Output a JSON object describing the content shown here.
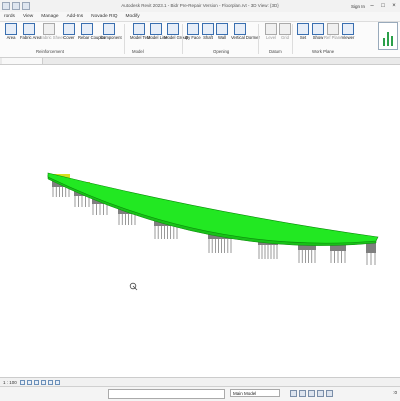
{
  "window": {
    "title": "Autodesk Revit 2023.1 - Bidr Pre-Repair Version - Floorplan.rvt - 3D View: {3D}",
    "signin_label": "Sign In",
    "minimize_glyph": "–",
    "maximize_glyph": "□",
    "close_glyph": "×"
  },
  "menubar": {
    "items": [
      "rords",
      "View",
      "Manage",
      "Add-Ins",
      "Novade RIQ",
      "Modify"
    ]
  },
  "ribbon": {
    "tools": [
      {
        "label": "Area",
        "style": "normal"
      },
      {
        "label": "Fabric Area",
        "style": "normal"
      },
      {
        "label": "Fabric Sheet",
        "style": "normal"
      },
      {
        "label": "Cover",
        "style": "normal"
      },
      {
        "label": "Rebar Coupler",
        "style": "normal"
      },
      {
        "label": "Component",
        "style": "normal"
      },
      {
        "label": "Model Text",
        "style": "normal"
      },
      {
        "label": "Model Line",
        "style": "normal"
      },
      {
        "label": "Model Group",
        "style": "normal"
      },
      {
        "label": "By Face",
        "style": "normal"
      },
      {
        "label": "Shaft",
        "style": "normal"
      },
      {
        "label": "Wall",
        "style": "normal"
      },
      {
        "label": "Vertical Dormer",
        "style": "normal"
      },
      {
        "label": "Level",
        "style": "gray"
      },
      {
        "label": "Grid",
        "style": "gray"
      },
      {
        "label": "Set",
        "style": "normal"
      },
      {
        "label": "Show",
        "style": "normal"
      },
      {
        "label": "Ref Plane",
        "style": "gray"
      },
      {
        "label": "Viewer",
        "style": "normal"
      }
    ],
    "panels": [
      "Reinforcement",
      "Model",
      "Opening",
      "Datum",
      "Work Plane"
    ]
  },
  "viewport": {
    "deck_color": "#22e822",
    "pier_color": "#7f7f7f",
    "bearing_color": "#d8e020"
  },
  "view_control": {
    "scale": "1 : 100"
  },
  "statusbar": {
    "tip": "",
    "model_label": "Main Model",
    "filter_label": ":0"
  }
}
